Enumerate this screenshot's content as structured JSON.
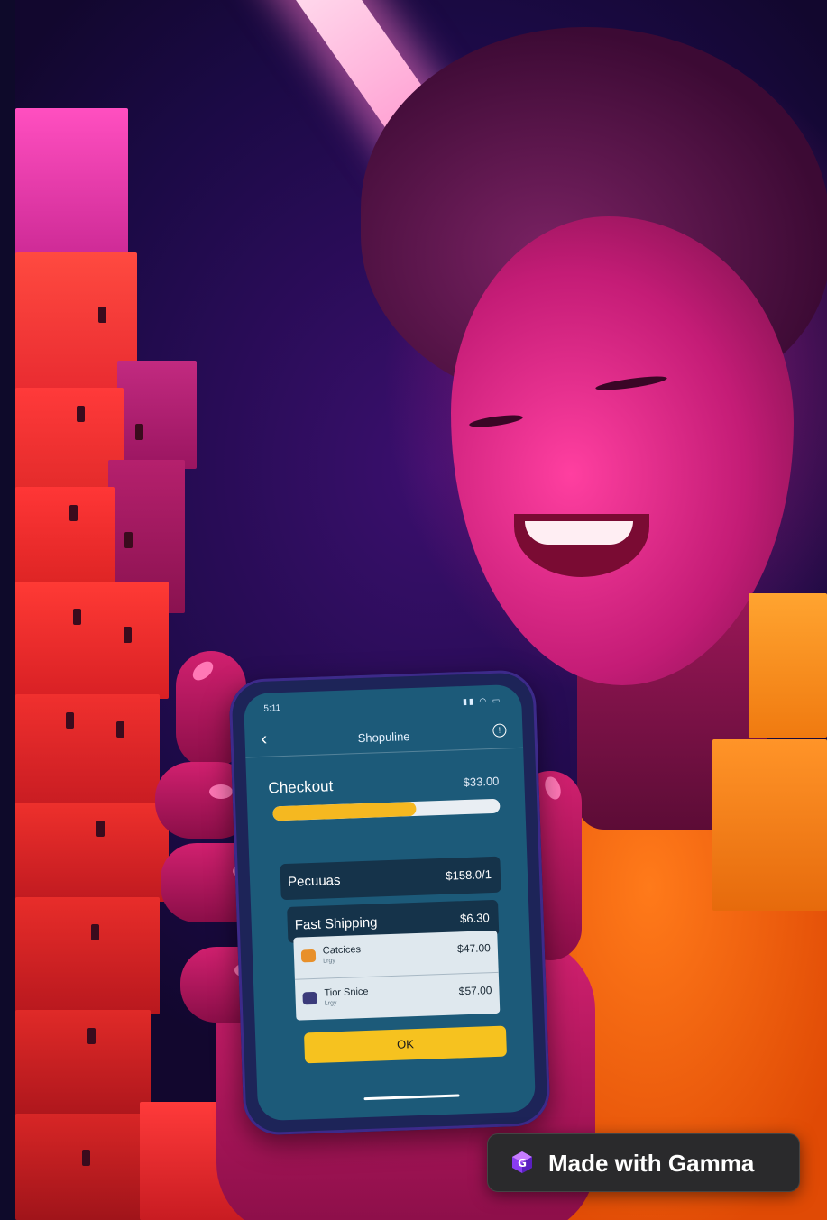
{
  "phone": {
    "status_time": "5:11",
    "title": "Shopuline",
    "checkout": {
      "label": "Checkout",
      "amount": "$33.00",
      "progress": 0.63
    },
    "rows": [
      {
        "label": "Pecuuas",
        "value": "$158.0/1"
      },
      {
        "label": "Fast Shipping",
        "value": "$6.30"
      }
    ],
    "items": [
      {
        "name": "Catcices",
        "sub": "Lrgy",
        "price": "$47.00",
        "icon_color": "#e8902a"
      },
      {
        "name": "Tior Snice",
        "sub": "Lrgy",
        "price": "$57.00",
        "icon_color": "#3b3b7a"
      }
    ],
    "ok_label": "OK"
  },
  "badge": {
    "text": "Made with Gamma"
  },
  "colors": {
    "accent_yellow": "#f6c21f",
    "screen_blue": "#1c5a79",
    "box_red": "#e8322b",
    "shirt_orange": "#ff7a1a"
  }
}
